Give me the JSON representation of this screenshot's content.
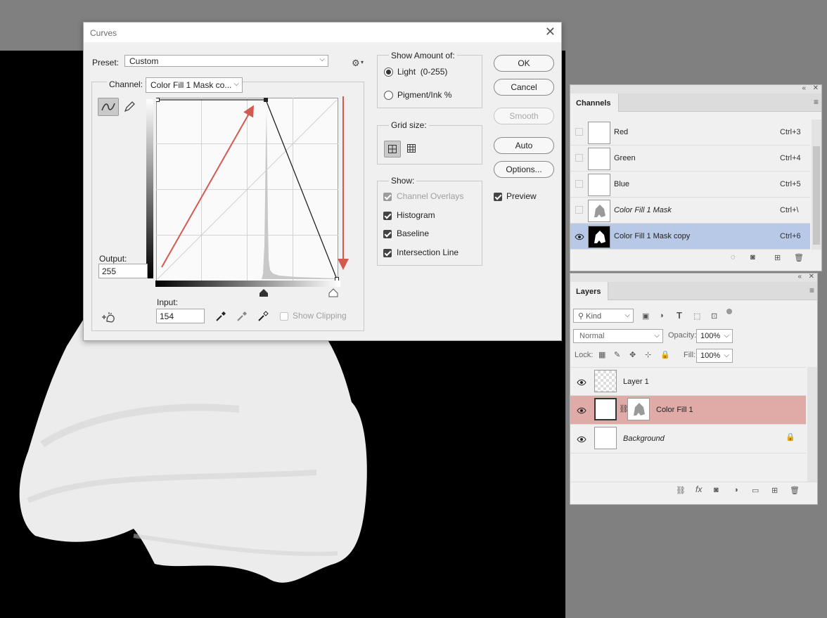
{
  "curves_dialog": {
    "title": "Curves",
    "preset_label": "Preset:",
    "preset_value": "Custom",
    "channel_label": "Channel:",
    "channel_value": "Color Fill 1 Mask co...",
    "output_label": "Output:",
    "output_value": "255",
    "input_label": "Input:",
    "input_value": "154",
    "show_clipping_label": "Show Clipping",
    "show_amount": {
      "title": "Show Amount of:",
      "light_label": "Light  (0-255)",
      "pigment_label": "Pigment/Ink %"
    },
    "grid_size_title": "Grid size:",
    "show": {
      "title": "Show:",
      "channel_overlays": "Channel Overlays",
      "histogram": "Histogram",
      "baseline": "Baseline",
      "intersection_line": "Intersection Line"
    },
    "buttons": {
      "ok": "OK",
      "cancel": "Cancel",
      "smooth": "Smooth",
      "auto": "Auto",
      "options": "Options..."
    },
    "preview_label": "Preview",
    "curve_points": [
      [
        0,
        255
      ],
      [
        154,
        255
      ],
      [
        255,
        0
      ]
    ]
  },
  "channels_panel": {
    "tab": "Channels",
    "rows": [
      {
        "name": "Red",
        "shortcut": "Ctrl+3"
      },
      {
        "name": "Green",
        "shortcut": "Ctrl+4"
      },
      {
        "name": "Blue",
        "shortcut": "Ctrl+5"
      },
      {
        "name": "Color Fill 1 Mask",
        "shortcut": "Ctrl+\\"
      },
      {
        "name": "Color Fill 1 Mask copy",
        "shortcut": "Ctrl+6"
      }
    ]
  },
  "layers_panel": {
    "tab": "Layers",
    "kind_filter": "Kind",
    "blend_mode": "Normal",
    "opacity_label": "Opacity:",
    "opacity_value": "100%",
    "lock_label": "Lock:",
    "fill_label": "Fill:",
    "fill_value": "100%",
    "layers": [
      {
        "name": "Layer 1"
      },
      {
        "name": "Color Fill 1"
      },
      {
        "name": "Background"
      }
    ]
  },
  "colors": {
    "accent_red": "#d25a50",
    "selected_channel": "#b7c9e6",
    "selected_layer": "#e0aaa6"
  }
}
